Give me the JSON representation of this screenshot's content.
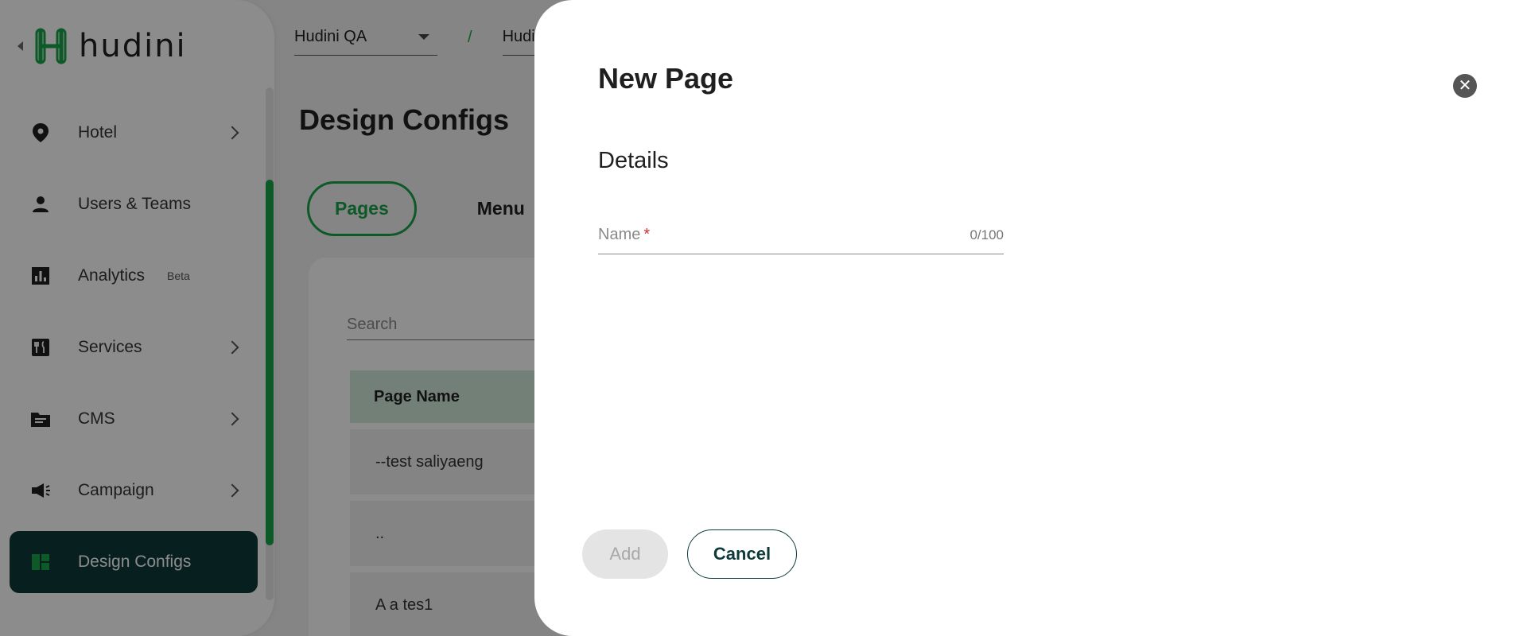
{
  "app": {
    "logo_text": "hudini",
    "brand_color": "#1aa34a",
    "dark_color": "#0f3a3a"
  },
  "topbar": {
    "property_select": "Hudini QA",
    "separator": "/",
    "second_select": "Hudini"
  },
  "sidebar": {
    "items": [
      {
        "label": "Hotel",
        "icon": "location-pin-icon",
        "has_chevron": true
      },
      {
        "label": "Users & Teams",
        "icon": "person-icon",
        "has_chevron": false
      },
      {
        "label": "Analytics",
        "icon": "analytics-icon",
        "badge": "Beta",
        "has_chevron": false
      },
      {
        "label": "Services",
        "icon": "restaurant-icon",
        "has_chevron": true
      },
      {
        "label": "CMS",
        "icon": "folder-icon",
        "has_chevron": true
      },
      {
        "label": "Campaign",
        "icon": "megaphone-icon",
        "has_chevron": true
      },
      {
        "label": "Design Configs",
        "icon": "dashboard-icon",
        "active": true
      }
    ]
  },
  "main": {
    "title": "Design Configs",
    "tabs": [
      {
        "label": "Pages",
        "active": true
      },
      {
        "label": "Menu",
        "active": false
      }
    ],
    "search_placeholder": "Search",
    "table": {
      "header": "Page Name",
      "rows": [
        "--test saliyaeng",
        "..",
        "A a tes1"
      ]
    }
  },
  "drawer": {
    "title": "New Page",
    "section": "Details",
    "name_field": {
      "label": "Name",
      "required_mark": "*",
      "value": "",
      "counter": "0/100"
    },
    "add_label": "Add",
    "cancel_label": "Cancel"
  }
}
